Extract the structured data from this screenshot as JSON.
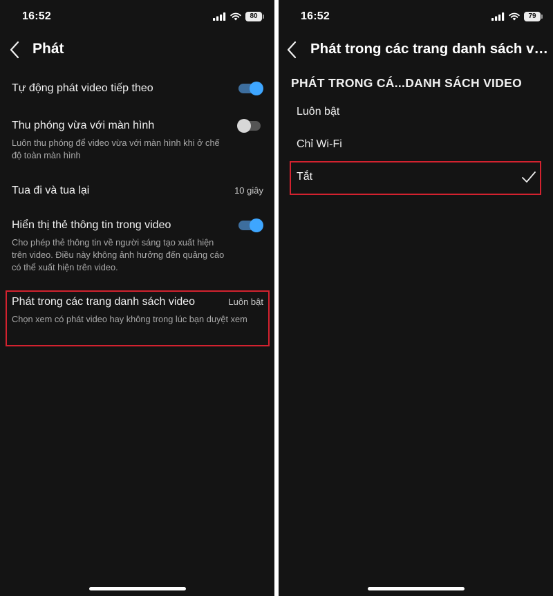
{
  "left": {
    "status_bar": {
      "time": "16:52",
      "battery": "80"
    },
    "app_bar": {
      "title": "Phát"
    },
    "settings": [
      {
        "title": "Tự động phát video tiếp theo",
        "toggle": "on"
      },
      {
        "title": "Thu phóng vừa với màn hình",
        "description": "Luôn thu phóng để video vừa với màn hình khi ở chế độ toàn màn hình",
        "toggle": "off"
      },
      {
        "title": "Tua đi và tua lại",
        "value": "10 giây"
      },
      {
        "title": "Hiển thị thẻ thông tin trong video",
        "description": "Cho phép thẻ thông tin về người sáng tạo xuất hiện trên video. Điều này không ảnh hưởng đến quảng cáo có thể xuất hiện trên video.",
        "toggle": "on"
      },
      {
        "title": "Phát trong các trang danh sách video",
        "description": "Chọn xem có phát video hay không trong lúc bạn duyệt xem",
        "value": "Luôn bật",
        "highlighted": true
      }
    ]
  },
  "right": {
    "status_bar": {
      "time": "16:52",
      "battery": "79"
    },
    "app_bar": {
      "title": "Phát trong các trang danh sách vi..."
    },
    "section_heading": "PHÁT TRONG CÁ...DANH SÁCH VIDEO",
    "options": [
      {
        "label": "Luôn bật",
        "selected": false
      },
      {
        "label": "Chỉ Wi-Fi",
        "selected": false
      },
      {
        "label": "Tắt",
        "selected": true,
        "highlighted": true
      }
    ]
  },
  "colors": {
    "background": "#141414",
    "toggle_on": "#3ea6ff",
    "highlight": "#d3222f",
    "secondary_text": "#a9a9a9"
  },
  "icons": [
    "back-arrow-icon",
    "signal-icon",
    "wifi-icon",
    "battery-icon",
    "checkmark-icon"
  ]
}
